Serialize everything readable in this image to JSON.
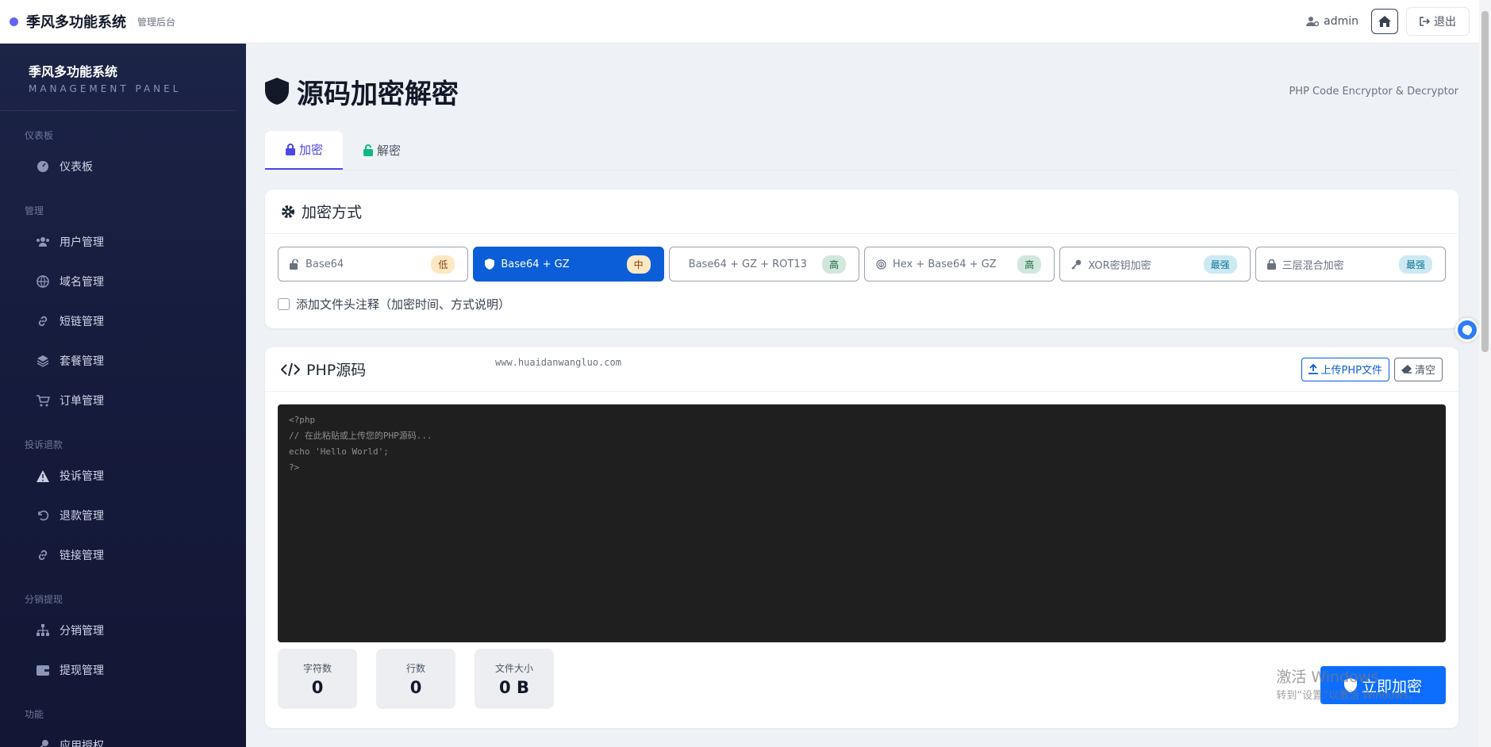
{
  "topbar": {
    "title": "季风多功能系统",
    "subtitle": "管理后台",
    "user": "admin",
    "logout": "退出"
  },
  "sidebar": {
    "brand_title": "季风多功能系统",
    "brand_sub": "MANAGEMENT PANEL",
    "groups": [
      {
        "title": "仪表板",
        "items": [
          "仪表板"
        ]
      },
      {
        "title": "管理",
        "items": [
          "用户管理",
          "域名管理",
          "短链管理",
          "套餐管理",
          "订单管理"
        ]
      },
      {
        "title": "投诉退款",
        "items": [
          "投诉管理",
          "退款管理",
          "链接管理"
        ]
      },
      {
        "title": "分销提现",
        "items": [
          "分销管理",
          "提现管理"
        ]
      },
      {
        "title": "功能",
        "items": [
          "应用授权"
        ]
      }
    ]
  },
  "page": {
    "title": "源码加密解密",
    "subtitle": "PHP Code Encryptor & Decryptor",
    "tabs": [
      "加密",
      "解密"
    ]
  },
  "methods_card": {
    "title": "加密方式",
    "methods": [
      {
        "label": "Base64",
        "badge": "低"
      },
      {
        "label": "Base64 + GZ",
        "badge": "中"
      },
      {
        "label": "Base64 + GZ + ROT13",
        "badge": "高"
      },
      {
        "label": "Hex + Base64 + GZ",
        "badge": "高"
      },
      {
        "label": "XOR密钥加密",
        "badge": "最强"
      },
      {
        "label": "三层混合加密",
        "badge": "最强"
      }
    ],
    "option_label": "添加文件头注释（加密时间、方式说明）"
  },
  "source_card": {
    "title": "PHP源码",
    "watermark": "www.huaidanwangluo.com",
    "upload_label": "上传PHP文件",
    "clear_label": "清空",
    "placeholder": "<?php\n// 在此粘贴或上传您的PHP源码...\necho 'Hello World';\n?>",
    "stats": [
      {
        "label": "字符数",
        "value": "0"
      },
      {
        "label": "行数",
        "value": "0"
      },
      {
        "label": "文件大小",
        "value": "0 B"
      }
    ],
    "encrypt_label": "立即加密",
    "windows_line1": "激活 Windows",
    "windows_line2": "转到“设置”以激活 Windows。"
  }
}
